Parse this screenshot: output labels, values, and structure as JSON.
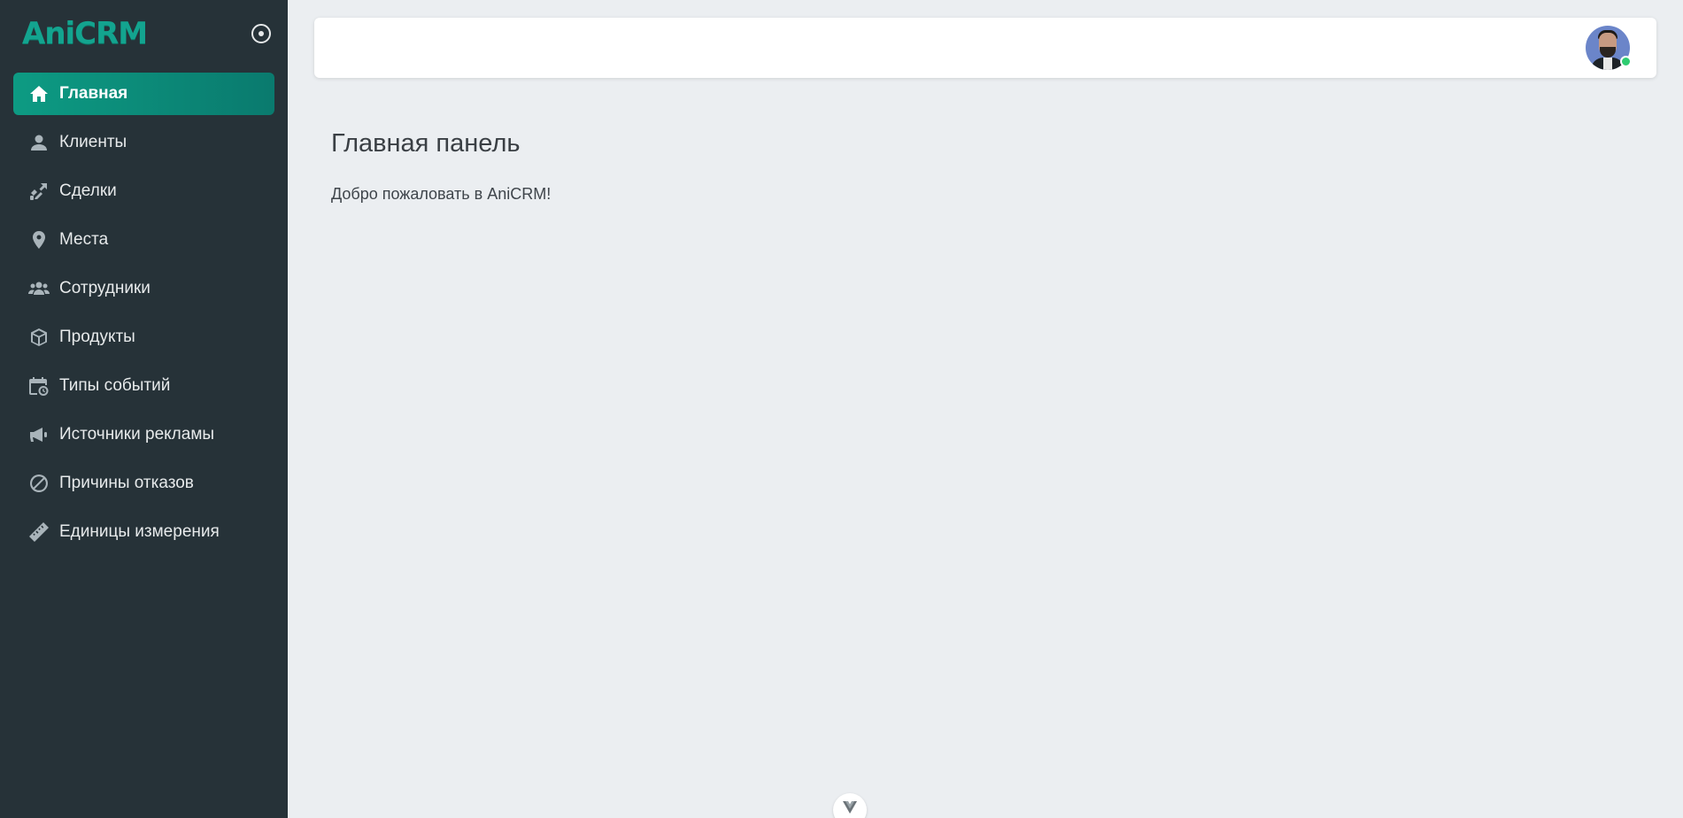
{
  "app": {
    "logo": "AniCRM"
  },
  "sidebar": {
    "items": [
      {
        "label": "Главная",
        "icon": "home-icon",
        "active": true
      },
      {
        "label": "Клиенты",
        "icon": "user-icon"
      },
      {
        "label": "Сделки",
        "icon": "handshake-icon"
      },
      {
        "label": "Места",
        "icon": "map-marker-icon"
      },
      {
        "label": "Сотрудники",
        "icon": "users-icon"
      },
      {
        "label": "Продукты",
        "icon": "box-icon"
      },
      {
        "label": "Типы событий",
        "icon": "calendar-clock-icon"
      },
      {
        "label": "Источники рекламы",
        "icon": "megaphone-icon"
      },
      {
        "label": "Причины отказов",
        "icon": "ban-icon"
      },
      {
        "label": "Единицы измерения",
        "icon": "ruler-icon"
      }
    ]
  },
  "main": {
    "title": "Главная панель",
    "welcome": "Добро пожаловать в AniCRM!"
  },
  "colors": {
    "sidebar_bg": "#263238",
    "accent": "#0d9b83",
    "page_bg": "#ebeef1",
    "online": "#2ecc71"
  }
}
